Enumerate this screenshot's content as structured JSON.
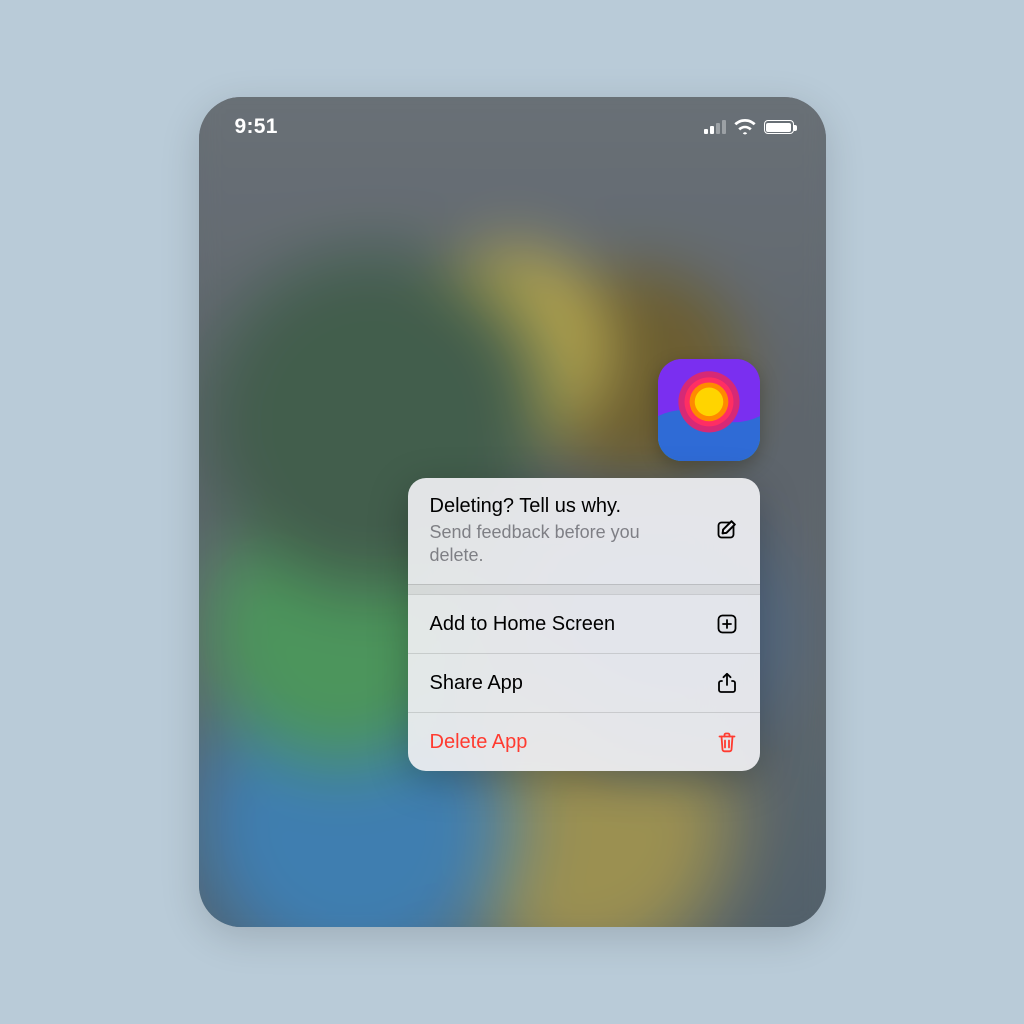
{
  "status": {
    "time": "9:51"
  },
  "app": {
    "icon_name": "sunset-app-icon"
  },
  "menu": {
    "header": {
      "title": "Deleting? Tell us why.",
      "subtitle": "Send feedback before you delete."
    },
    "add_home": "Add to Home Screen",
    "share": "Share App",
    "delete": "Delete App"
  },
  "colors": {
    "danger": "#ff3b30",
    "accent": "#7a2ff0"
  }
}
